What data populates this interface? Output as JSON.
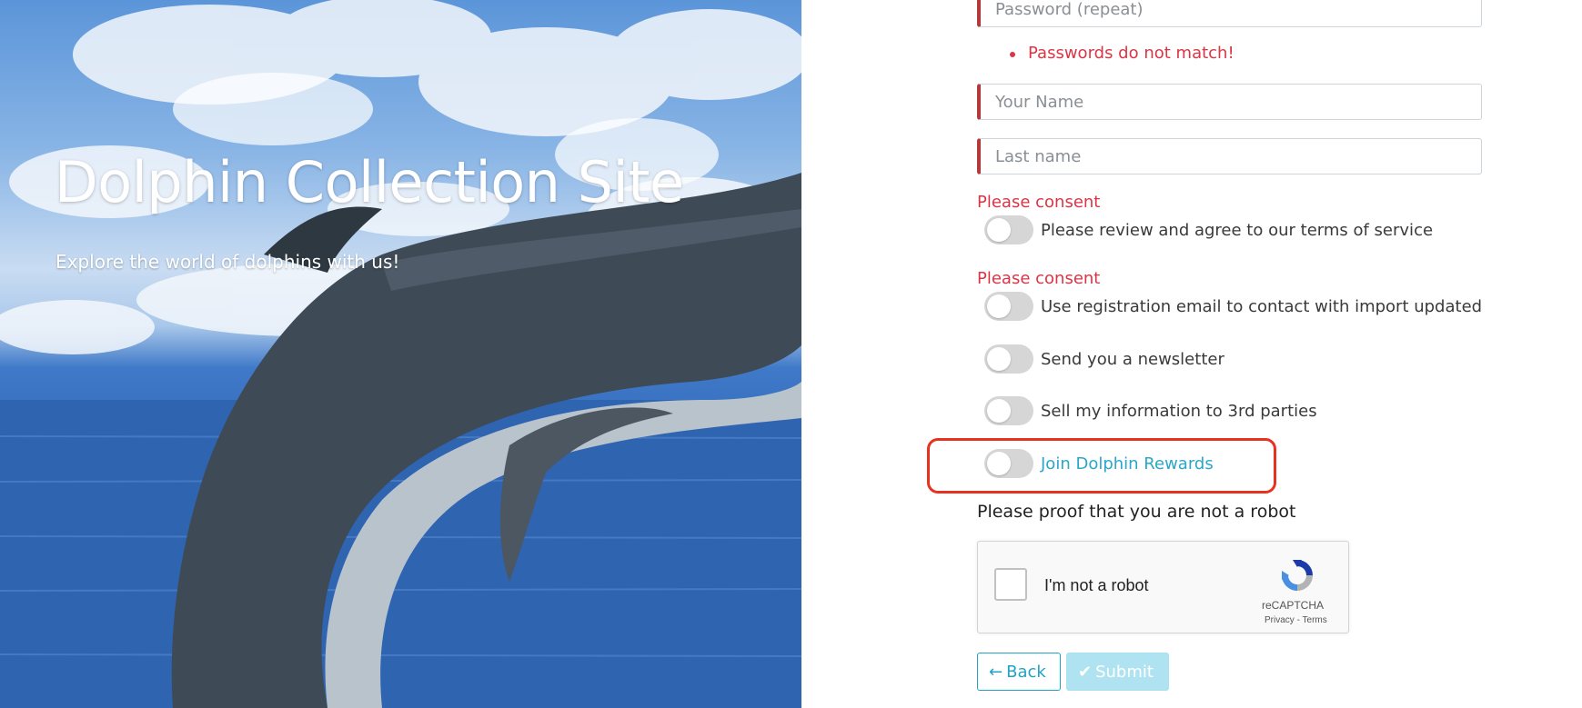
{
  "hero": {
    "title": "Dolphin Collection Site",
    "subtitle": "Explore the world of dolphins with us!"
  },
  "form": {
    "password_repeat_placeholder": "Password (repeat)",
    "errors": [
      "Passwords do not match!"
    ],
    "first_name_placeholder": "Your Name",
    "last_name_placeholder": "Last name",
    "consent_error_label": "Please consent",
    "toggles": [
      {
        "label": "Please review and agree to our terms of service",
        "checked": false,
        "required": true
      },
      {
        "label": "Use registration email to contact with import updated",
        "checked": false,
        "required": true
      },
      {
        "label": "Send you a newsletter",
        "checked": false,
        "required": false
      },
      {
        "label": "Sell my information to 3rd parties",
        "checked": false,
        "required": false
      },
      {
        "label": "Join Dolphin Rewards",
        "checked": false,
        "required": false,
        "link": true,
        "highlighted": true
      }
    ],
    "robot_prompt": "Please proof that you are not a robot",
    "recaptcha": {
      "label": "I'm not a robot",
      "brand": "reCAPTCHA",
      "privacy": "Privacy",
      "separator": "-",
      "terms": "Terms"
    },
    "buttons": {
      "back": "Back",
      "submit": "Submit"
    }
  },
  "colors": {
    "accent": "#1fa3c7",
    "error": "#dc3545",
    "invalid_border": "#b33a3a",
    "highlight": "#e8321f",
    "submit_disabled": "#b0e3f1"
  },
  "icons": {
    "back": "arrow-left-icon",
    "submit": "check-icon",
    "recaptcha": "recaptcha-logo-icon"
  }
}
